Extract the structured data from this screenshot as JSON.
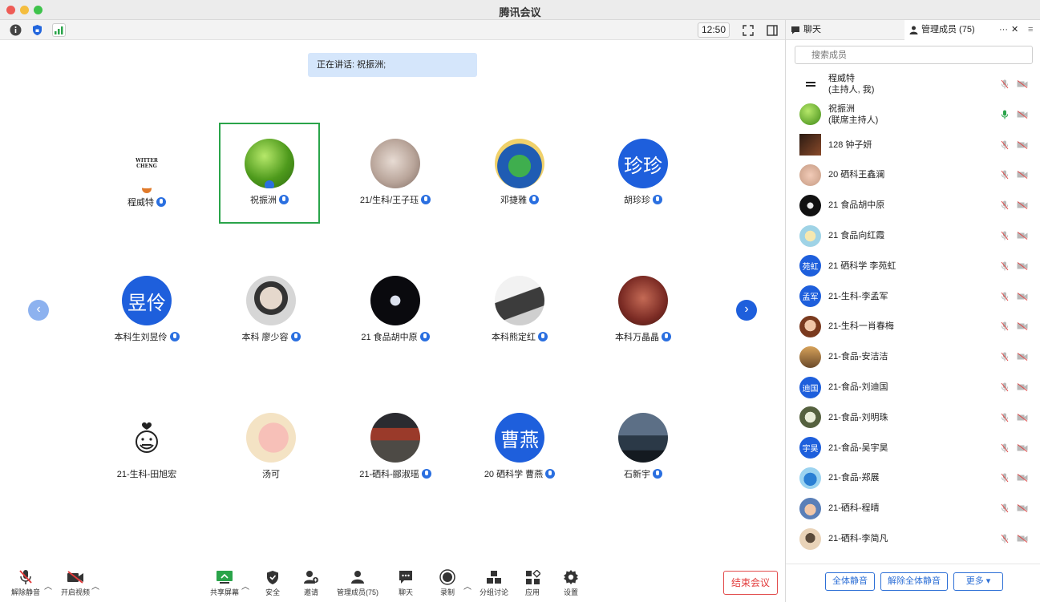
{
  "window": {
    "title": "腾讯会议"
  },
  "toolbar_top": {
    "clock": "12:50"
  },
  "speaking": {
    "label": "正在讲话: 祝振洲;"
  },
  "tiles": [
    {
      "name": "程威特",
      "avatar_text": "WITTER\nCHENG"
    },
    {
      "name": "祝振洲"
    },
    {
      "name": "21/生科/王子珏"
    },
    {
      "name": "邓捷雅"
    },
    {
      "name": "胡珍珍",
      "avatar_text": "珍珍"
    },
    {
      "name": "本科生刘昱伶",
      "avatar_text": "昱伶"
    },
    {
      "name": "本科 廖少容"
    },
    {
      "name": "21 食品胡中原"
    },
    {
      "name": "本科熊定红"
    },
    {
      "name": "本科万晶晶"
    },
    {
      "name": "21-生科-田旭宏"
    },
    {
      "name": "汤可"
    },
    {
      "name": "21-硒科-郦淑瑶"
    },
    {
      "name": "20 硒科学 曹燕",
      "avatar_text": "曹燕"
    },
    {
      "name": "石新宇"
    }
  ],
  "bottom_toolbar": {
    "unmute": "解除静音",
    "video": "开启视频",
    "share": "共享屏幕",
    "security": "安全",
    "invite": "邀请",
    "members": "管理成员(75)",
    "chat": "聊天",
    "record": "录制",
    "breakout": "分组讨论",
    "apps": "应用",
    "settings": "设置",
    "end": "结束会议"
  },
  "panel": {
    "tab_chat": "聊天",
    "tab_members": "管理成员 (75)",
    "more": "···",
    "close": "✕",
    "menu": "≡",
    "search_placeholder": "搜索成员",
    "members": [
      {
        "name": "程威特",
        "sub": "(主持人, 我)"
      },
      {
        "name": "祝振洲",
        "sub": "(联席主持人)"
      },
      {
        "name": "128 钟子妍",
        "sub": ""
      },
      {
        "name": "20 硒科王鑫澜",
        "sub": ""
      },
      {
        "name": "21 食品胡中原",
        "sub": ""
      },
      {
        "name": "21 食品向红霞",
        "sub": ""
      },
      {
        "name": "21 硒科学 李苑虹",
        "sub": "",
        "avatar_text": "苑虹"
      },
      {
        "name": "21-生科-李孟军",
        "sub": "",
        "avatar_text": "孟军"
      },
      {
        "name": "21-生科一肖春梅",
        "sub": ""
      },
      {
        "name": "21-食品-安洁洁",
        "sub": ""
      },
      {
        "name": "21-食品-刘迪国",
        "sub": "",
        "avatar_text": "迪国"
      },
      {
        "name": "21-食品-刘明珠",
        "sub": ""
      },
      {
        "name": "21-食品-吴宇昊",
        "sub": "",
        "avatar_text": "宇昊"
      },
      {
        "name": "21-食品-郑展",
        "sub": ""
      },
      {
        "name": "21-硒科-程晴",
        "sub": ""
      },
      {
        "name": "21-硒科-李简凡",
        "sub": ""
      }
    ],
    "mute_all": "全体静音",
    "unmute_all": "解除全体静音",
    "more_btn": "更多 ▾"
  },
  "colors": {
    "accent": "#1e5fdc",
    "active_border": "#2aa44a",
    "end_red": "#e23b3b"
  }
}
